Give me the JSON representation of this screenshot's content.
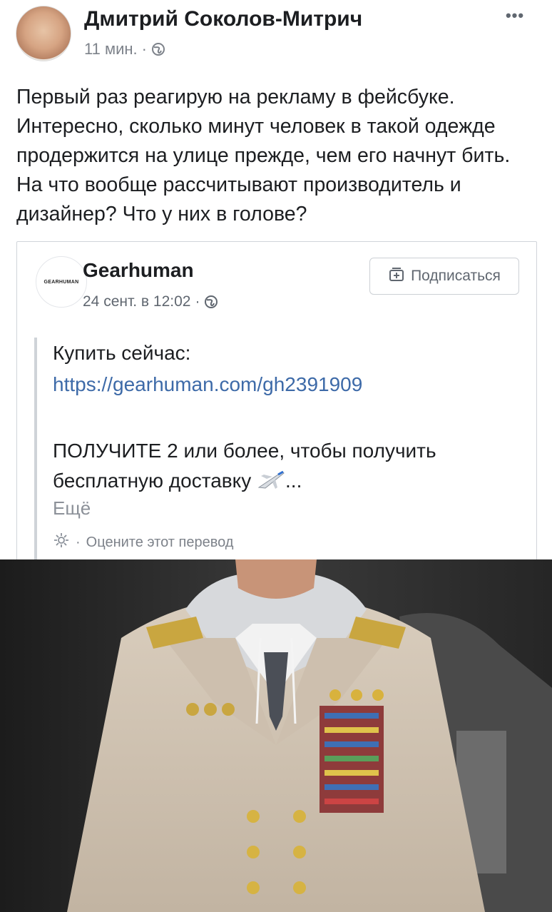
{
  "post": {
    "author_name": "Дмитрий Соколов-Митрич",
    "time": "11 мин.",
    "separator": "·",
    "more_label": "•••",
    "text": "Первый раз реагирую на рекламу в фейсбуке. Интересно, сколько минут человек в такой одежде продержится на улице прежде, чем его начнут бить. На что вообще рассчитывают производитель и дизайнер? Что у них в голове?"
  },
  "shared_post": {
    "page_name": "Gearhuman",
    "logo_text": "GEARHUMAN",
    "time": "24 сент. в 12:02",
    "separator": "·",
    "follow_label": "Подписаться",
    "buy_label": "Купить сейчас:",
    "link": "https://gearhuman.com/gh2391909",
    "offer_text": "ПОЛУЧИТЕ 2 или более, чтобы получить бесплатную доставку",
    "ellipsis": "...",
    "see_more": "Ещё",
    "translation_label": "Оцените этот перевод"
  },
  "icons": {
    "globe": "globe-icon",
    "airplane": "airplane-icon",
    "gear": "gear-icon",
    "follow": "follow-icon"
  },
  "colors": {
    "link": "#3d6aa8",
    "meta_text": "#7d828a"
  }
}
